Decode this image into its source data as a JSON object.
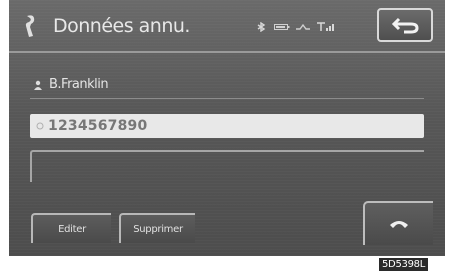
{
  "header": {
    "title": "Données annu.",
    "icons": [
      "phone-book-icon",
      "bluetooth-icon",
      "battery-icon",
      "signal-icon",
      "antenna-icon"
    ],
    "back_icon": "back-arrow-icon"
  },
  "entry": {
    "name": "B.Franklin",
    "number": "1234567890",
    "number_icon": "phone-number-icon",
    "name_icon": "person-icon"
  },
  "actions": {
    "edit_label": "Editer",
    "delete_label": "Supprimer",
    "call_icon": "handset-icon"
  },
  "image_code": "5D5398L",
  "colors": {
    "screen": "#575757",
    "text": "#e8e8e8",
    "highlight_field": "#e8e8e8"
  }
}
